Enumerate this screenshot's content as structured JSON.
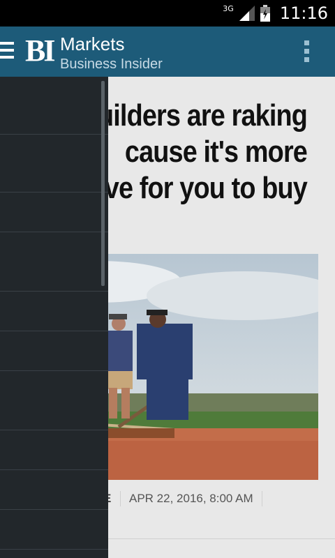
{
  "status_bar": {
    "network": "3G",
    "time": "11:16"
  },
  "app_bar": {
    "logo": "BI",
    "title": "Markets",
    "subtitle": "Business Insider"
  },
  "article": {
    "headline_lines": [
      "uilders are raking",
      "cause it's more",
      "ve for you to buy"
    ],
    "author_fragment": "E",
    "date": "APR 22, 2016, 8:00 AM"
  },
  "colors": {
    "app_bar": "#1d5b79",
    "drawer": "#22272b",
    "status_bar": "#000000"
  }
}
